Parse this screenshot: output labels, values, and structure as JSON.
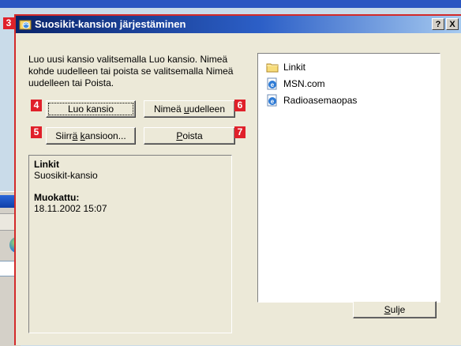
{
  "dialog": {
    "title": "Suosikit-kansion järjestäminen",
    "help_button": "?",
    "close_button": "X",
    "description": "Luo uusi kansio valitsemalla Luo kansio. Nimeä kohde uudelleen tai poista se valitsemalla Nimeä uudelleen tai Poista.",
    "buttons": {
      "create_folder": "Luo kansio",
      "rename_pre": "Nimeä ",
      "rename_key": "u",
      "rename_post": "udelleen",
      "move_pre": "Siirr",
      "move_key1": "ä",
      "move_mid": " ",
      "move_key2": "k",
      "move_post": "ansioon...",
      "delete_key": "P",
      "delete_post": "oista",
      "close_key": "S",
      "close_post": "ulje"
    },
    "info": {
      "name": "Linkit",
      "type": "Suosikit-kansio",
      "modified_label": "Muokattu:",
      "modified_value": "18.11.2002 15:07"
    },
    "favorites": [
      {
        "icon": "folder-icon",
        "label": "Linkit"
      },
      {
        "icon": "ie-page-icon",
        "label": "MSN.com"
      },
      {
        "icon": "ie-page-icon",
        "label": "Radioasemaopas"
      }
    ]
  },
  "callouts": [
    "3",
    "4",
    "5",
    "6",
    "7"
  ],
  "colors": {
    "callout_red": "#e0202a",
    "title_blue": "#0a246a",
    "dialog_face": "#ece9d8"
  }
}
